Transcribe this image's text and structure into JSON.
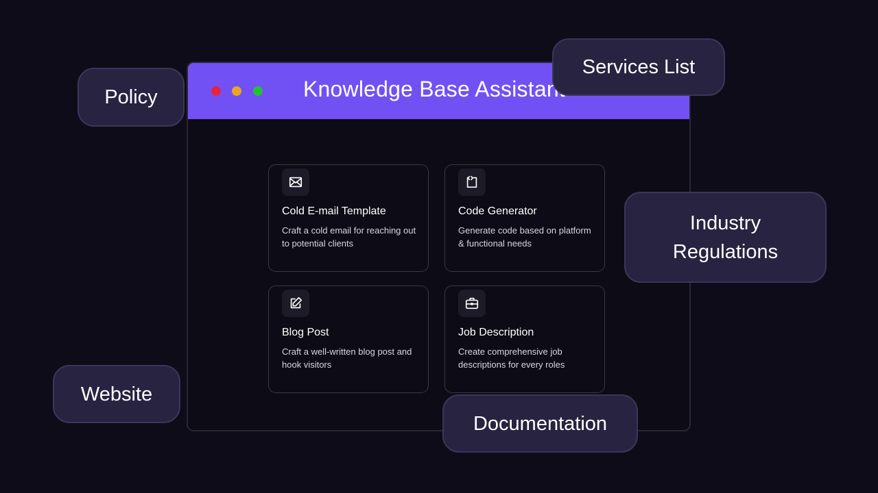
{
  "window": {
    "title": "Knowledge Base Assistant",
    "dots": [
      "#e8243d",
      "#e8a622",
      "#24c232"
    ],
    "accent": "#7251f4"
  },
  "cards": [
    {
      "icon": "envelope-icon",
      "title": "Cold E-mail Template",
      "desc": "Craft a cold email for reaching out to potential clients"
    },
    {
      "icon": "code-icon",
      "title": "Code Generator",
      "desc": "Generate code based on platform & functional needs"
    },
    {
      "icon": "edit-icon",
      "title": "Blog Post",
      "desc": "Craft a well-written blog post and hook visitors"
    },
    {
      "icon": "briefcase-icon",
      "title": "Job Description",
      "desc": "Create comprehensive job descriptions for every roles"
    }
  ],
  "tags": {
    "policy": "Policy",
    "services": "Services List",
    "industry": "Industry Regulations",
    "website": "Website",
    "documentation": "Documentation"
  }
}
